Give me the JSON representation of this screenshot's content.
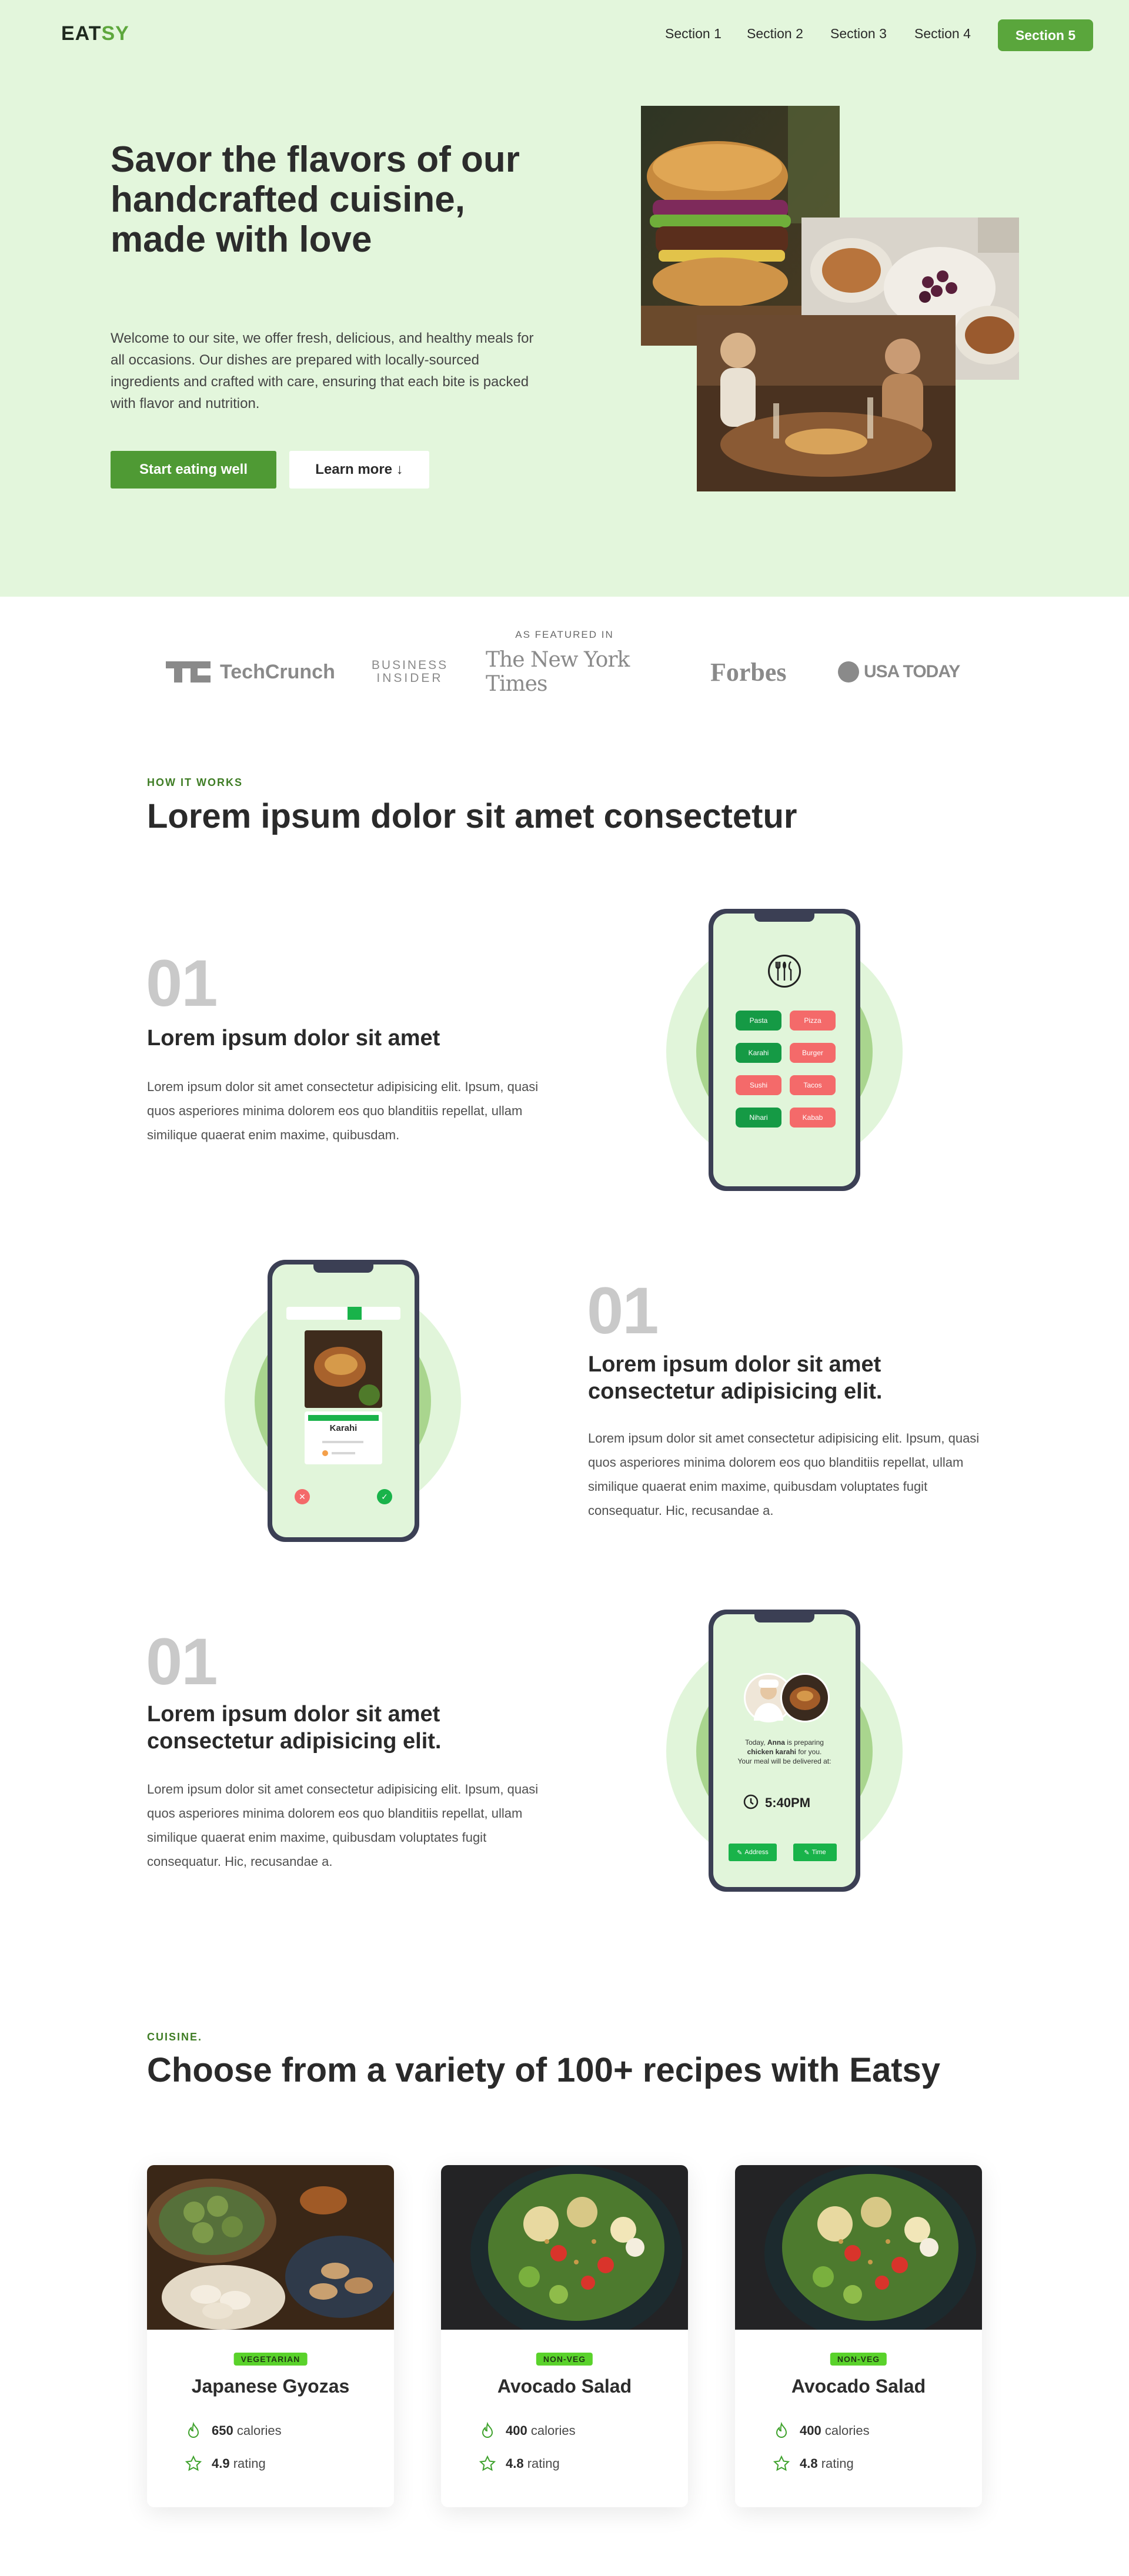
{
  "nav": {
    "logo_part1": "EAT",
    "logo_part2": "SY",
    "links": [
      "Section 1",
      "Section 2",
      "Section 3",
      "Section 4"
    ],
    "cta": "Section 5"
  },
  "hero": {
    "title": "Savor the flavors of our handcrafted cuisine, made with love",
    "description": "Welcome to our site, we offer fresh, delicious, and healthy meals for all occasions. Our dishes are prepared with locally-sourced ingredients and crafted with care, ensuring that each bite is packed with flavor and nutrition.",
    "primary_button": "Start eating well",
    "secondary_button": "Learn more ↓"
  },
  "featured": {
    "label": "AS FEATURED IN",
    "logos": [
      "TechCrunch",
      "BUSINESS",
      "INSIDER",
      "The New York Times",
      "Forbes",
      "USA TODAY"
    ]
  },
  "how_it_works": {
    "eyebrow": "HOW IT WORKS",
    "title": "Lorem ipsum dolor sit amet consectetur",
    "steps": [
      {
        "number": "01",
        "title": "Lorem ipsum dolor sit amet",
        "text": "Lorem ipsum dolor sit amet consectetur adipisicing elit. Ipsum, quasi quos asperiores minima dolorem eos quo blanditiis repellat, ullam similique quaerat enim maxime, quibusdam.",
        "phone": {
          "menu_left": [
            "Pasta",
            "Karahi",
            "Sushi",
            "Nihari"
          ],
          "menu_right": [
            "Pizza",
            "Burger",
            "Tacos",
            "Kabab"
          ]
        }
      },
      {
        "number": "01",
        "title": "Lorem ipsum dolor sit amet consectetur adipisicing elit.",
        "text": "Lorem ipsum dolor sit amet consectetur adipisicing elit. Ipsum, quasi quos asperiores minima dolorem eos quo blanditiis repellat, ullam similique quaerat enim maxime, quibusdam voluptates fugit consequatur. Hic, recusandae a.",
        "phone": {
          "dish": "Karahi"
        }
      },
      {
        "number": "01",
        "title": "Lorem ipsum dolor sit amet consectetur adipisicing elit.",
        "text": "Lorem ipsum dolor sit amet consectetur adipisicing elit. Ipsum, quasi quos asperiores minima dolorem eos quo blanditiis repellat, ullam similique quaerat enim maxime, quibusdam voluptates fugit consequatur. Hic, recusandae a.",
        "phone": {
          "line1_pre": "Today,",
          "line1_name": "Anna",
          "line1_post": "is preparing",
          "line2_dish": "chicken karahi",
          "line2_post": "for you.",
          "line3": "Your meal will be delivered at:",
          "time": "5:40PM",
          "btn_left": "Address",
          "btn_right": "Time"
        }
      }
    ]
  },
  "cuisine": {
    "eyebrow": "CUISINE.",
    "title": "Choose from a variety of 100+ recipes with Eatsy",
    "cards": [
      {
        "badge": "VEGETARIAN",
        "title": "Japanese Gyozas",
        "calories": "650",
        "calories_label": "calories",
        "rating": "4.9",
        "rating_label": "rating"
      },
      {
        "badge": "NON-VEG",
        "title": "Avocado Salad",
        "calories": "400",
        "calories_label": "calories",
        "rating": "4.8",
        "rating_label": "rating"
      },
      {
        "badge": "NON-VEG",
        "title": "Avocado Salad",
        "calories": "400",
        "calories_label": "calories",
        "rating": "4.8",
        "rating_label": "rating"
      }
    ]
  },
  "colors": {
    "brand_green": "#5aa63c",
    "hero_bg": "#e3f6dc",
    "badge_green": "#5ad22b"
  }
}
